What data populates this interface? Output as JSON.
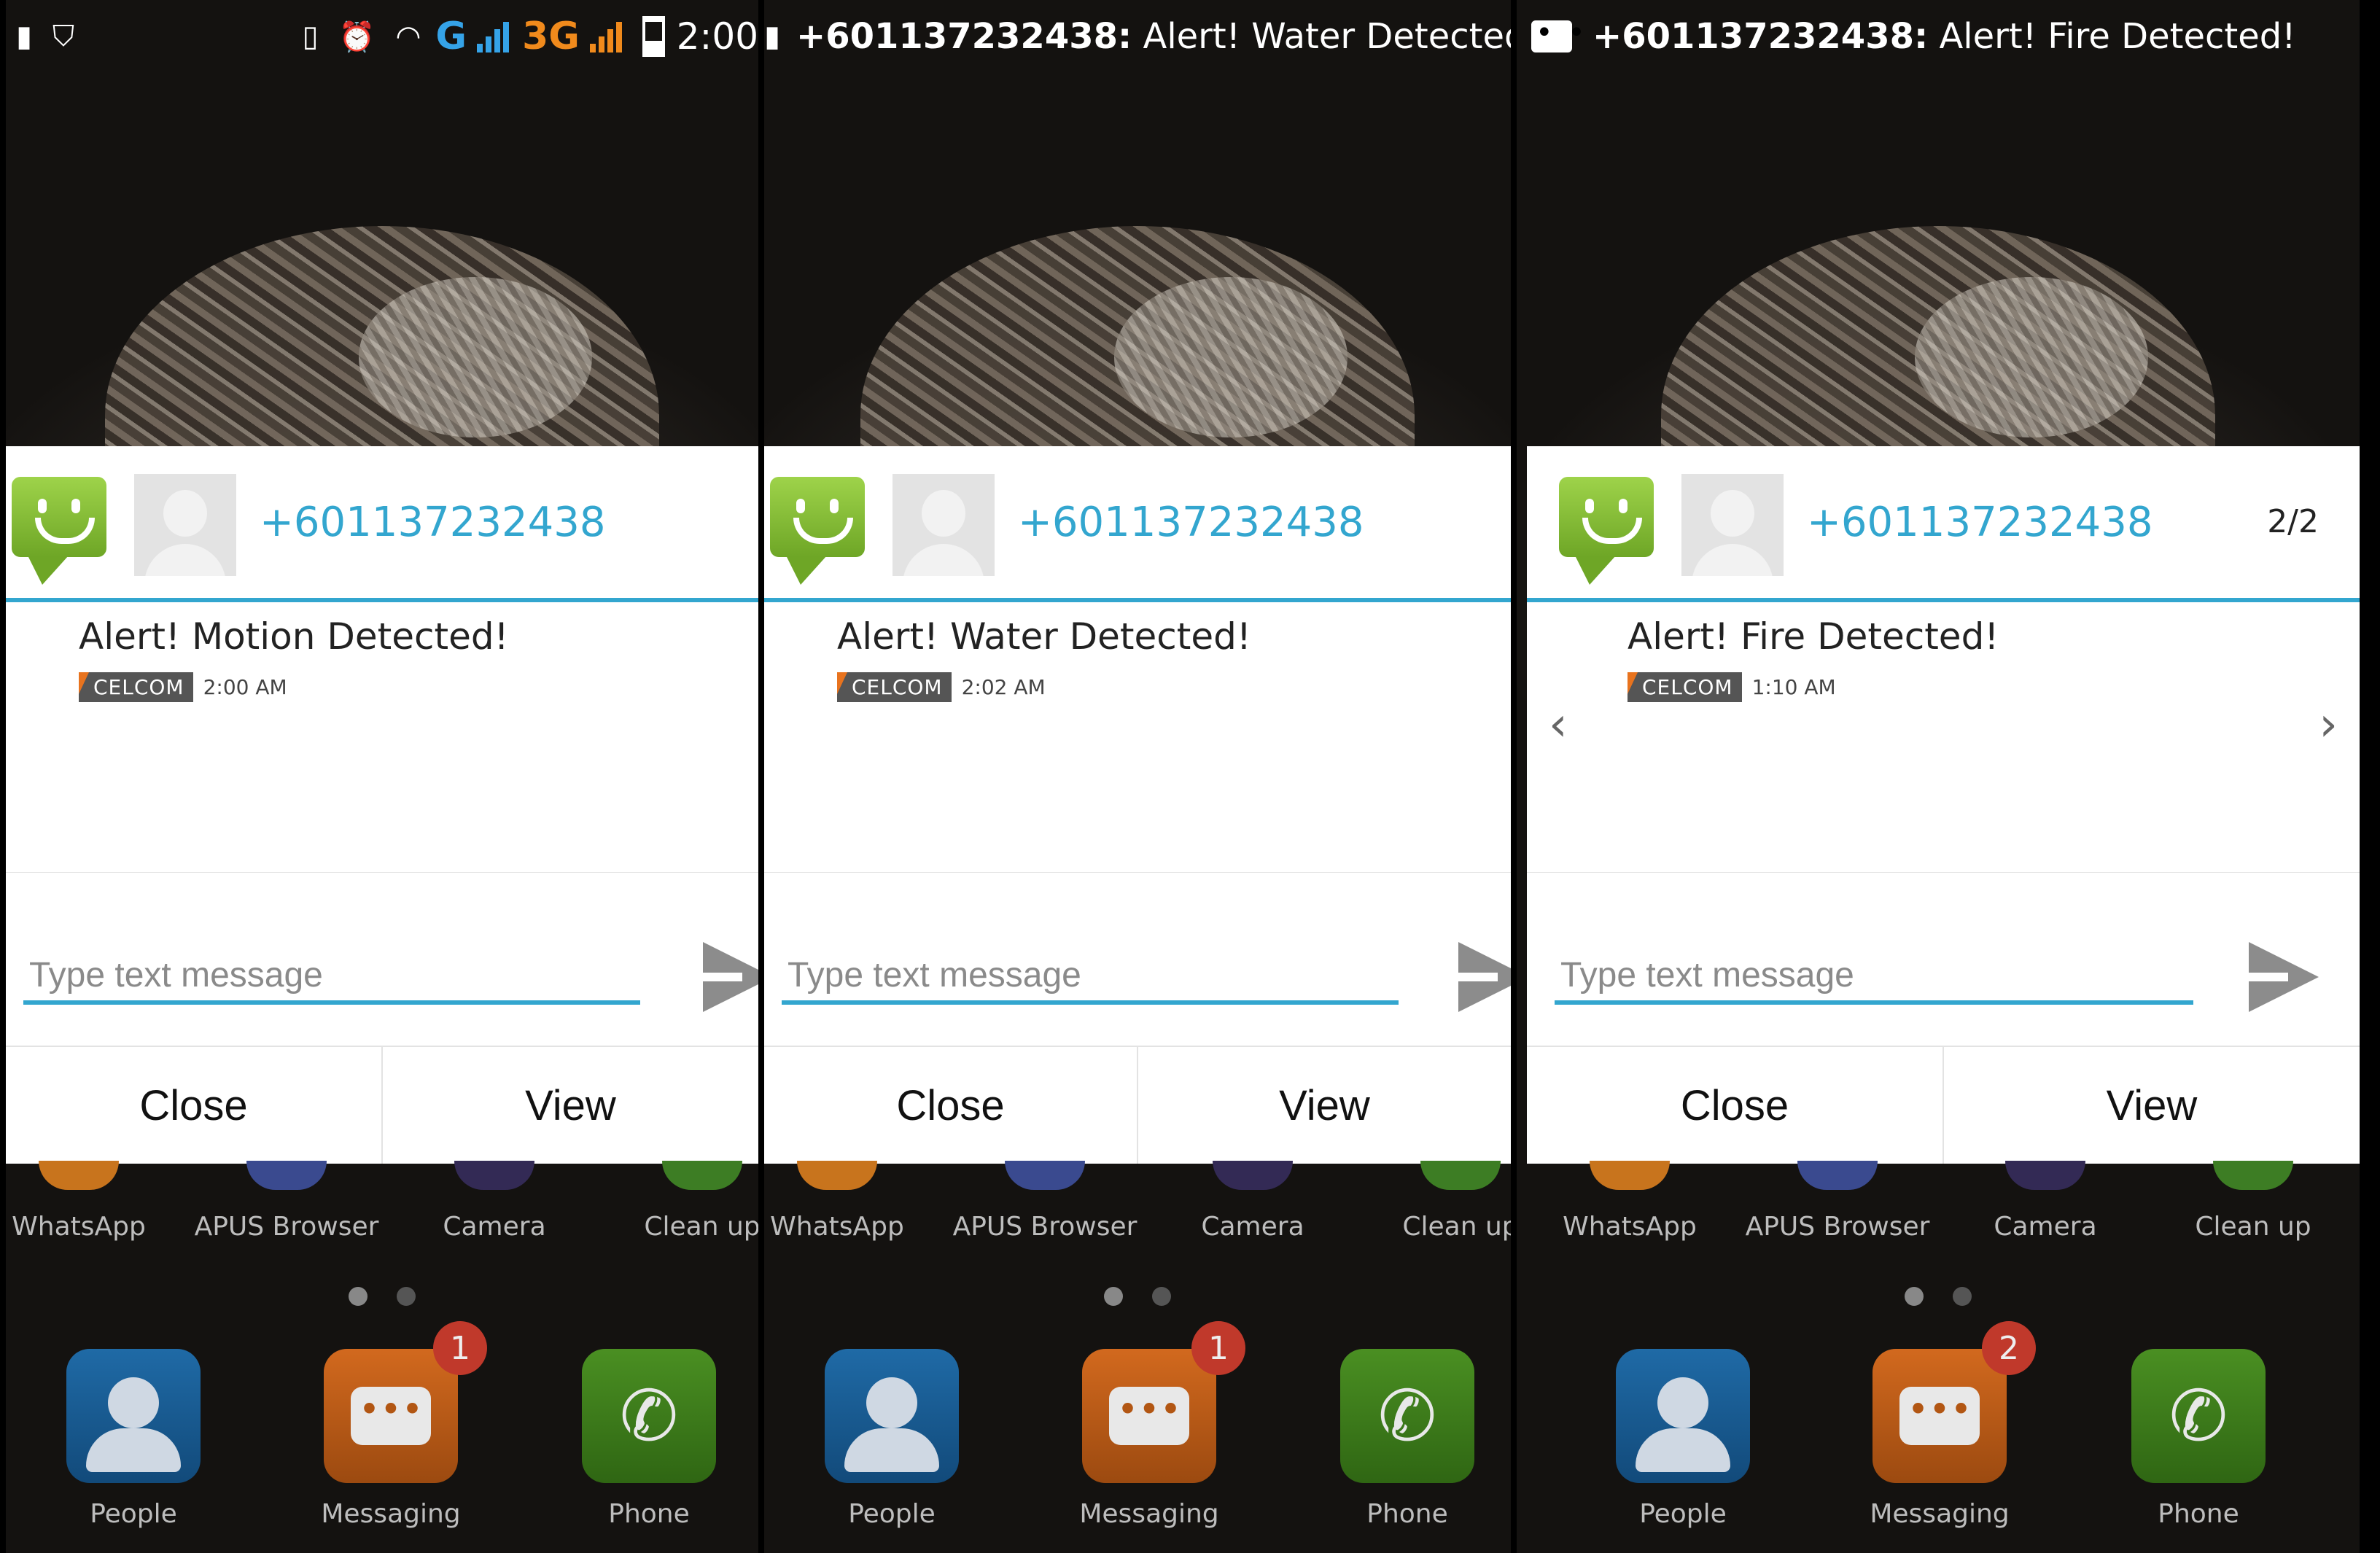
{
  "statusbar": {
    "icons": [
      "sim-icon",
      "shield-icon",
      "vibrate-icon",
      "alarm-icon",
      "wifi-icon",
      "signal-icon",
      "battery-icon"
    ],
    "network_1": "G",
    "network_2": "3G",
    "time": "2:00"
  },
  "tickers": [
    {
      "sender": "+601137232438:",
      "text": " Alert! Water Detected!"
    },
    {
      "sender": "+601137232438:",
      "text": " Alert! Fire Detected!"
    }
  ],
  "panels": [
    {
      "sender": "+601137232438",
      "message": "Alert! Motion Detected!",
      "carrier": "CELCOM",
      "time": "2:00 AM",
      "placeholder": "Type text message",
      "close_label": "Close",
      "view_label": "View",
      "messaging_badge": "1"
    },
    {
      "sender": "+601137232438",
      "message": "Alert! Water Detected!",
      "carrier": "CELCOM",
      "time": "2:02 AM",
      "placeholder": "Type text message",
      "close_label": "Close",
      "view_label": "View",
      "messaging_badge": "1"
    },
    {
      "sender": "+601137232438",
      "message": "Alert! Fire Detected!",
      "carrier": "CELCOM",
      "time": "1:10 AM",
      "counter": "2/2",
      "placeholder": "Type text message",
      "close_label": "Close",
      "view_label": "View",
      "messaging_badge": "2"
    }
  ],
  "apps": [
    "WhatsApp",
    "APUS Browser",
    "Camera",
    "Clean up"
  ],
  "dock": {
    "people": "People",
    "messaging": "Messaging",
    "phone": "Phone"
  },
  "colors": {
    "accent": "#33a6cf",
    "sms_green": "#8cc63f",
    "badge": "#c0392b",
    "carrier_orange": "#e8731e"
  }
}
